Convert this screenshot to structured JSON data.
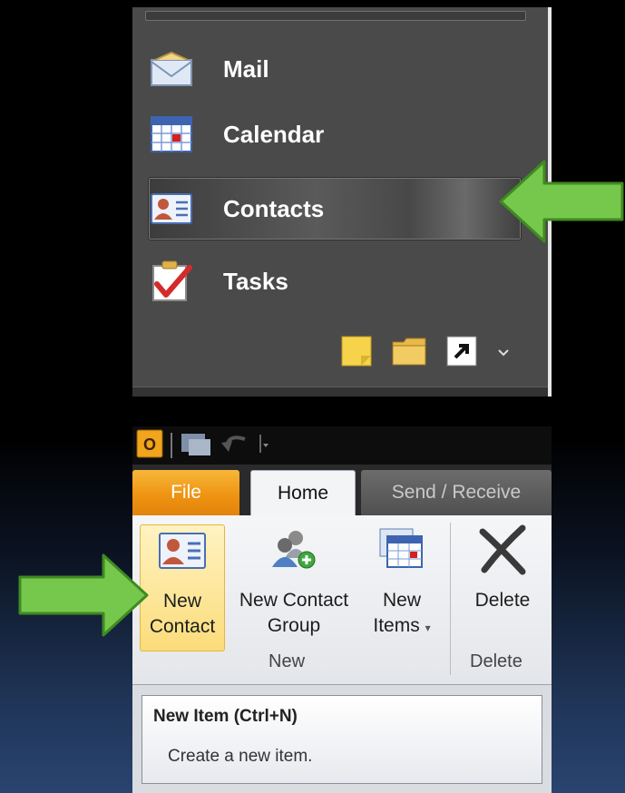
{
  "nav_pane": {
    "items": [
      {
        "label": "Mail",
        "icon": "mail-icon"
      },
      {
        "label": "Calendar",
        "icon": "calendar-icon"
      },
      {
        "label": "Contacts",
        "icon": "contact-card-icon",
        "selected": true
      },
      {
        "label": "Tasks",
        "icon": "tasks-checkbox-icon"
      }
    ],
    "bottom_icons": [
      "note-icon",
      "folder-icon",
      "shortcut-icon",
      "configure-chevron-icon"
    ]
  },
  "ribbon": {
    "qat_icons": [
      "outlook-app-icon",
      "send-receive-icon",
      "undo-icon",
      "customize-qat-icon"
    ],
    "tabs": [
      {
        "label": "File"
      },
      {
        "label": "Home",
        "selected": true
      },
      {
        "label": "Send / Receive"
      }
    ],
    "buttons": {
      "new_contact": "New Contact",
      "new_contact_line1": "New",
      "new_contact_line2": "Contact",
      "new_group_line1": "New Contact",
      "new_group_line2": "Group",
      "new_items_line1": "New",
      "new_items_line2": "Items",
      "delete": "Delete"
    },
    "groups": {
      "new": "New",
      "delete": "Delete"
    },
    "tooltip": {
      "title": "New Item (Ctrl+N)",
      "description": "Create a new item."
    }
  },
  "colors": {
    "highlight_arrow": "#6cc644",
    "file_tab": "#ef9412",
    "nav_background": "#4a4a4a"
  }
}
